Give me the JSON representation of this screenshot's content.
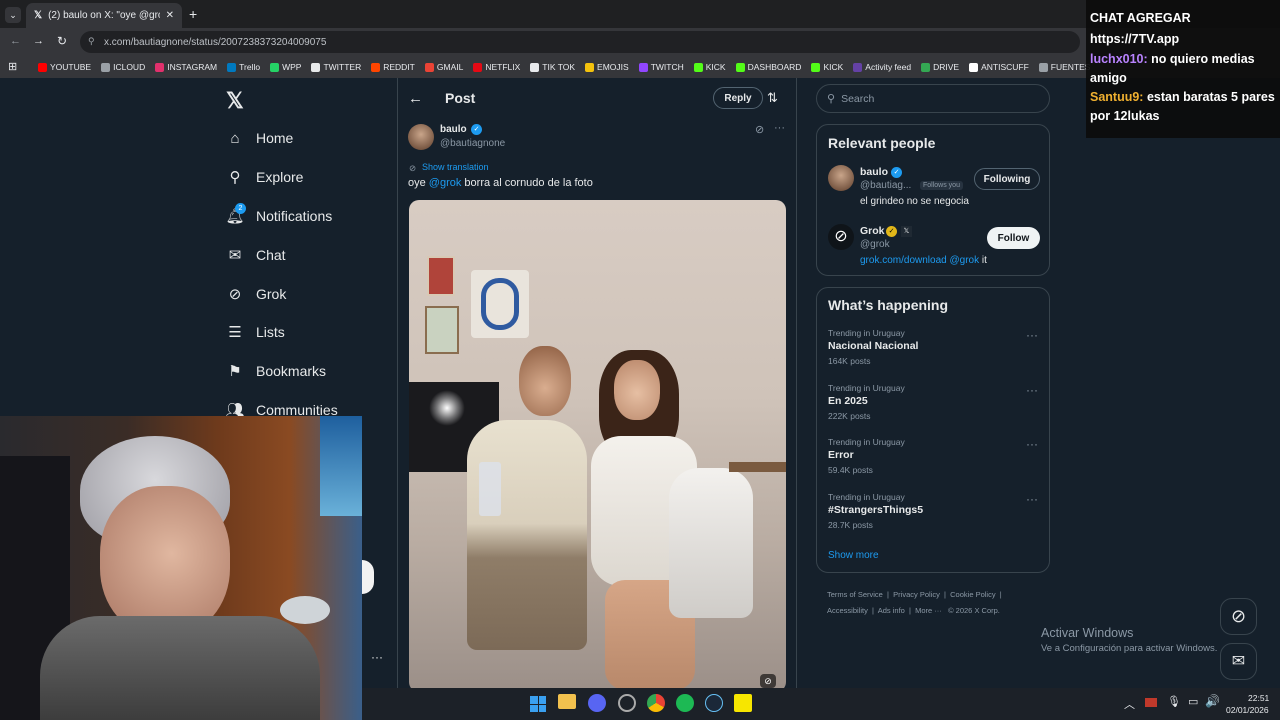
{
  "browser": {
    "tab_title": "(2) baulo on X: \"oye @grok bor",
    "url": "x.com/bautiagnone/status/2007238373204009075",
    "bookmarks": [
      {
        "label": "YOUTUBE",
        "color": "#ff0000"
      },
      {
        "label": "ICLOUD",
        "color": "#9aa0a6"
      },
      {
        "label": "INSTAGRAM",
        "color": "#e1306c"
      },
      {
        "label": "Trello",
        "color": "#0079bf"
      },
      {
        "label": "WPP",
        "color": "#25d366"
      },
      {
        "label": "TWITTER",
        "color": "#e7e9ea"
      },
      {
        "label": "REDDIT",
        "color": "#ff4500"
      },
      {
        "label": "GMAIL",
        "color": "#ea4335"
      },
      {
        "label": "NETFLIX",
        "color": "#e50914"
      },
      {
        "label": "TIK TOK",
        "color": "#e8eaed"
      },
      {
        "label": "EMOJIS",
        "color": "#f4c20d"
      },
      {
        "label": "TWITCH",
        "color": "#9146ff"
      },
      {
        "label": "KICK",
        "color": "#53fc18"
      },
      {
        "label": "DASHBOARD",
        "color": "#53fc18"
      },
      {
        "label": "KICK",
        "color": "#53fc18"
      },
      {
        "label": "Activity feed",
        "color": "#6441a5"
      },
      {
        "label": "DRIVE",
        "color": "#34a853"
      },
      {
        "label": "ANTISCUFF",
        "color": "#ffffff"
      },
      {
        "label": "FUENTES",
        "color": "#9aa0a6"
      }
    ]
  },
  "nav": {
    "items": [
      {
        "label": "Home",
        "icon": "home-icon"
      },
      {
        "label": "Explore",
        "icon": "search-icon"
      },
      {
        "label": "Notifications",
        "icon": "bell-icon",
        "badge": "2"
      },
      {
        "label": "Chat",
        "icon": "mail-icon"
      },
      {
        "label": "Grok",
        "icon": "grok-icon"
      },
      {
        "label": "Lists",
        "icon": "list-icon"
      },
      {
        "label": "Bookmarks",
        "icon": "bookmark-icon"
      },
      {
        "label": "Communities",
        "icon": "people-icon"
      }
    ],
    "more_dots": "···"
  },
  "post": {
    "header_title": "Post",
    "reply_label": "Reply",
    "author_name": "baulo",
    "author_handle": "@bautiagnone",
    "show_translation": "Show translation",
    "text_prefix": "oye ",
    "text_mention": "@grok",
    "text_suffix": " borra al cornudo de la foto"
  },
  "search": {
    "placeholder": "Search"
  },
  "relevant": {
    "title": "Relevant people",
    "people": [
      {
        "name": "baulo",
        "handle": "@bautiag...",
        "follows_you": "Follows you",
        "button": "Following",
        "bio": "el grindeo no se negocia"
      },
      {
        "name": "Grok",
        "handle": "@grok",
        "button": "Follow",
        "bio_link": "grok.com/download",
        "bio_mention": "@grok",
        "bio_tail": " it"
      }
    ]
  },
  "happening": {
    "title": "What’s happening",
    "trends": [
      {
        "location": "Trending in Uruguay",
        "name": "Nacional Nacional",
        "count": "164K posts"
      },
      {
        "location": "Trending in Uruguay",
        "name": "En 2025",
        "count": "222K posts"
      },
      {
        "location": "Trending in Uruguay",
        "name": "Error",
        "count": "59.4K posts"
      },
      {
        "location": "Trending in Uruguay",
        "name": "#StrangersThings5",
        "count": "28.7K posts"
      }
    ],
    "show_more": "Show more"
  },
  "footer": {
    "links": [
      "Terms of Service",
      "Privacy Policy",
      "Cookie Policy",
      "Accessibility",
      "Ads info",
      "More ···"
    ],
    "copyright": "© 2026 X Corp."
  },
  "windows_watermark": {
    "line1": "Activar Windows",
    "line2": "Ve a Configuración para activar Windows."
  },
  "chat_overlay": {
    "line0": "CHAT AGREGAR",
    "line1": "https://7TV.app",
    "messages": [
      {
        "user": "luchx010:",
        "text": " no quiero medias amigo",
        "color": "#b983ff"
      },
      {
        "user": "Santuu9:",
        "text": " estan baratas 5 pares por 12lukas",
        "color": "#f0b030"
      }
    ]
  },
  "taskbar": {
    "time": "22:51",
    "date": "02/01/2026"
  },
  "colors": {
    "x_bg": "#15202b",
    "accent": "#1d9bf0",
    "border": "#38444d"
  }
}
